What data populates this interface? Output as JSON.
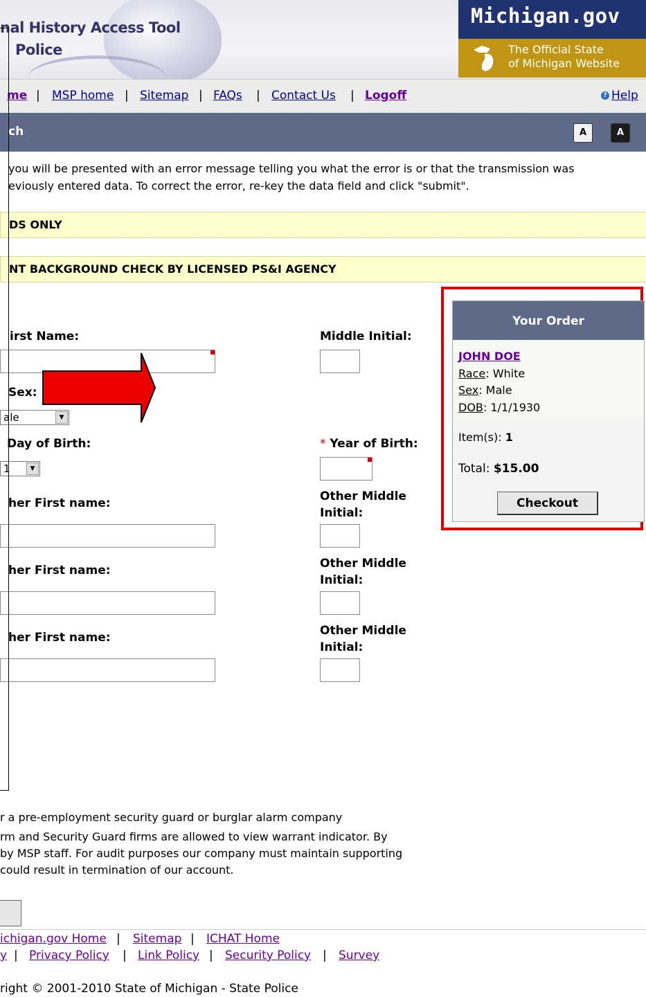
{
  "header": {
    "title_line1": "nal History Access Tool",
    "title_line2": "Police",
    "logo_main": "Michigan.gov",
    "logo_sub1": "The Official State",
    "logo_sub2": "of Michigan Website"
  },
  "nav": {
    "items": [
      "me",
      "MSP home",
      "Sitemap",
      "FAQs",
      "Contact Us",
      "Logoff"
    ],
    "separator": "|",
    "help": "Help"
  },
  "section_title": "ch",
  "font_buttons": [
    "A",
    "A"
  ],
  "intro": {
    "line1": "you will be presented with an error message telling you what the error is or that the transmission was",
    "line2": "eviously entered data. To correct the error, re-key the data field and click \"submit\"."
  },
  "banners": {
    "records_only": "DS ONLY",
    "background_check": "NT BACKGROUND CHECK BY LICENSED PS&I AGENCY"
  },
  "form": {
    "first_name_label": "irst Name:",
    "middle_initial_label": "Middle Initial:",
    "sex_label": "Sex:",
    "sex_value": "ale",
    "day_of_birth_label": "Day of Birth:",
    "day_value": "1",
    "year_required_mark": "*",
    "year_of_birth_label": "Year of Birth:",
    "other_first_name_label": "her First name:",
    "other_middle_label_1": "Other Middle",
    "other_middle_label_2": "Initial:"
  },
  "order": {
    "title": "Your Order",
    "name": "JOHN DOE",
    "race_label": "Race",
    "race_value": ": White",
    "sex_label": "Sex",
    "sex_value": ": Male",
    "dob_label": "DOB",
    "dob_value": ": 1/1/1930",
    "items_label": "Item(s): ",
    "items_value": "1",
    "total_label": "Total: ",
    "total_value": "$15.00",
    "checkout": "Checkout"
  },
  "legal": {
    "line1": "r a pre-employment security guard or burglar alarm company",
    "line2": "rm and Security Guard firms are allowed to view warrant indicator. By",
    "line3": "by MSP staff. For audit purposes our company must maintain supporting",
    "line4": " could result in termination of our account."
  },
  "footer": {
    "row1": [
      "ichigan.gov Home",
      "Sitemap",
      "ICHAT Home"
    ],
    "row1_lead": "",
    "row2_lead": "y",
    "row2": [
      "Privacy Policy",
      "Link Policy",
      "Security Policy",
      "Survey"
    ],
    "copyright": "right © 2001-2010 State of Michigan - State Police"
  },
  "colors": {
    "title_bar": "#5e6a8a",
    "highlight": "#e00000",
    "logo_blue": "#213272",
    "logo_gold": "#c09513",
    "banner_yellow": "#ffffcc"
  }
}
